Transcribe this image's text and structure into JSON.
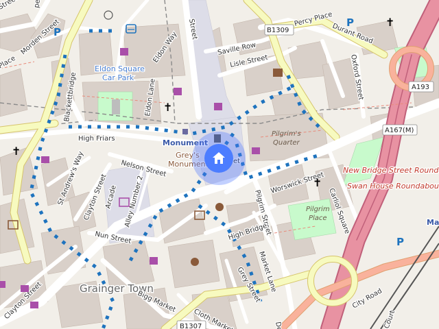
{
  "map": {
    "labels": {
      "morden_street": "Morden Street",
      "eldon_square_car_park_1": "Eldon Square",
      "eldon_square_car_park_2": "Car Park",
      "eldon_way": "Eldon Way",
      "street_top": "Street",
      "saville_row": "Saville Row",
      "lisle_street": "Lisle Street",
      "b1309": "B1309",
      "durant_road": "Durant Road",
      "percy_place": "Percy Place",
      "oxford_street": "Oxford Street",
      "a193": "A193",
      "a167m": "A167(M)",
      "blackett_bridge": "Blackettbridge",
      "eldon_lane": "Eldon Lane",
      "monument": "Monument",
      "greys_monument_1": "Grey's",
      "greys_monument_2": "Monument",
      "high_friars": "High Friars",
      "nelson_street": "Nelson Street",
      "pilgrims_quarter_1": "Pilgrim's",
      "pilgrims_quarter_2": "Quarter",
      "new_bridge_roundabout": "New Bridge Street Roundabout",
      "swan_house_roundabout": "Swan House Roundabout",
      "st_andrews_way": "St Andrew's Way",
      "clayton_street_upper": "Clayton Street",
      "arcade": "Arcade",
      "alley_number_2": "Alley Number 2",
      "worswick_street": "Worswick Street",
      "carliol_square": "Carliol Square",
      "pilgrim_street": "Pilgrim Street",
      "pilgrim_place_1": "Pilgrim",
      "pilgrim_place_2": "Place",
      "nun_street": "Nun Street",
      "high_bridge": "High Bridge",
      "market_lane": "Market Lane",
      "grey_street": "Grey Street",
      "grainger_town": "Grainger Town",
      "clayton_street_lower": "Clayton Street",
      "bigg_market": "Bigg Market",
      "cloth_market": "Cloth Market",
      "b1307": "B1307",
      "city_road": "City Road",
      "court": "Court",
      "ma": "Ma",
      "place_left": "Place",
      "street_topleft": "Street",
      "pen": "pen",
      "de": "De",
      "et": "et"
    },
    "icons": [
      "location-marker-icon",
      "parking-icon",
      "bus-station-icon",
      "shopping-icon",
      "church-icon",
      "cinema-icon",
      "library-icon",
      "theatre-icon",
      "monument-icon"
    ],
    "colors": {
      "background": "#f2efe9",
      "road": "#ffffff",
      "secondary_road": "#f7fabf",
      "motorway": "#e892a2",
      "trunk": "#f9b29c",
      "park": "#c8facc",
      "building": "#d9d0c9",
      "cycle_route": "#1e73be",
      "marker": "#4c7dff"
    }
  }
}
